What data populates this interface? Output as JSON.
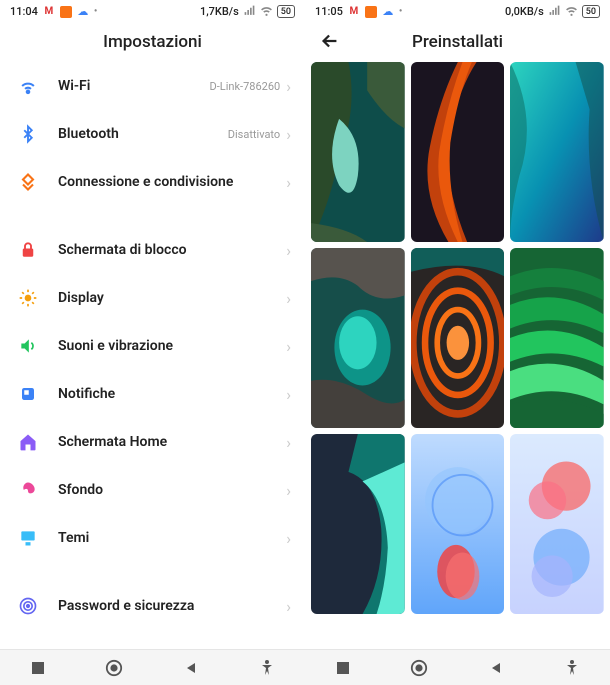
{
  "left": {
    "status": {
      "time": "11:04",
      "net": "1,7KB/s",
      "battery": "50"
    },
    "title": "Impostazioni",
    "items": [
      {
        "icon": "wifi",
        "label": "Wi-Fi",
        "value": "D-Link-786260",
        "color": "#3b82f6"
      },
      {
        "icon": "bluetooth",
        "label": "Bluetooth",
        "value": "Disattivato",
        "color": "#3b82f6"
      },
      {
        "icon": "share",
        "label": "Connessione e condivisione",
        "value": "",
        "color": "#f97316"
      }
    ],
    "items2": [
      {
        "icon": "lock",
        "label": "Schermata di blocco",
        "color": "#ef4444"
      },
      {
        "icon": "sun",
        "label": "Display",
        "color": "#f59e0b"
      },
      {
        "icon": "volume",
        "label": "Suoni e vibrazione",
        "color": "#22c55e"
      },
      {
        "icon": "bell",
        "label": "Notifiche",
        "color": "#3b82f6"
      },
      {
        "icon": "home",
        "label": "Schermata Home",
        "color": "#8b5cf6"
      },
      {
        "icon": "wallpaper",
        "label": "Sfondo",
        "color": "#ec4899"
      },
      {
        "icon": "themes",
        "label": "Temi",
        "color": "#38bdf8"
      }
    ],
    "items3": [
      {
        "icon": "fingerprint",
        "label": "Password e sicurezza",
        "color": "#6366f1"
      }
    ]
  },
  "right": {
    "status": {
      "time": "11:05",
      "net": "0,0KB/s",
      "battery": "50"
    },
    "title": "Preinstallati"
  }
}
